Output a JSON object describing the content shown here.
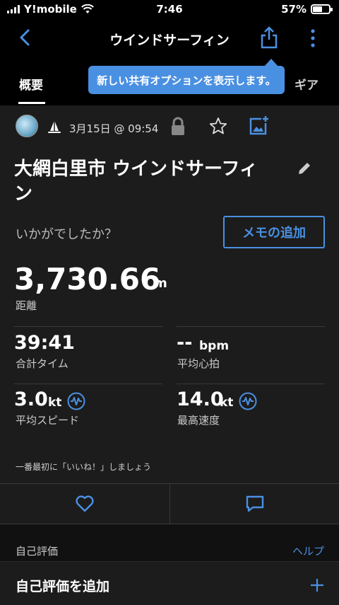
{
  "status_bar": {
    "carrier": "Y!mobile",
    "time": "7:46",
    "battery_percent": "57%",
    "battery_level": 0.57
  },
  "nav": {
    "title": "ウインドサーフィン"
  },
  "tabs": [
    {
      "label": "概要",
      "active": true
    },
    {
      "label": "ギア",
      "active": false
    }
  ],
  "tooltip": {
    "text": "新しい共有オプションを表示します。"
  },
  "activity": {
    "date": "3月15日 @ 09:54",
    "title": "大網白里市 ウインドサーフィン",
    "question": "いかがでしたか？",
    "memo_button": "メモの追加"
  },
  "distance": {
    "value": "3,730.66",
    "unit": "m",
    "label": "距離"
  },
  "stats": {
    "total_time": {
      "value": "39:41",
      "label": "合計タイム"
    },
    "avg_hr": {
      "value": "--",
      "unit": "bpm",
      "label": "平均心拍"
    },
    "avg_speed": {
      "value": "3.0",
      "unit": "kt",
      "label": "平均スピード"
    },
    "max_speed": {
      "value": "14.0",
      "unit": "kt",
      "label": "最高速度"
    }
  },
  "social": {
    "first_like_text": "一番最初に「いいね！」しましょう"
  },
  "self_eval": {
    "header": "自己評価",
    "help": "ヘルプ",
    "add_label": "自己評価を追加"
  },
  "colors": {
    "accent": "#4a90e2",
    "background": "#000000",
    "card": "#1c1c1c"
  }
}
